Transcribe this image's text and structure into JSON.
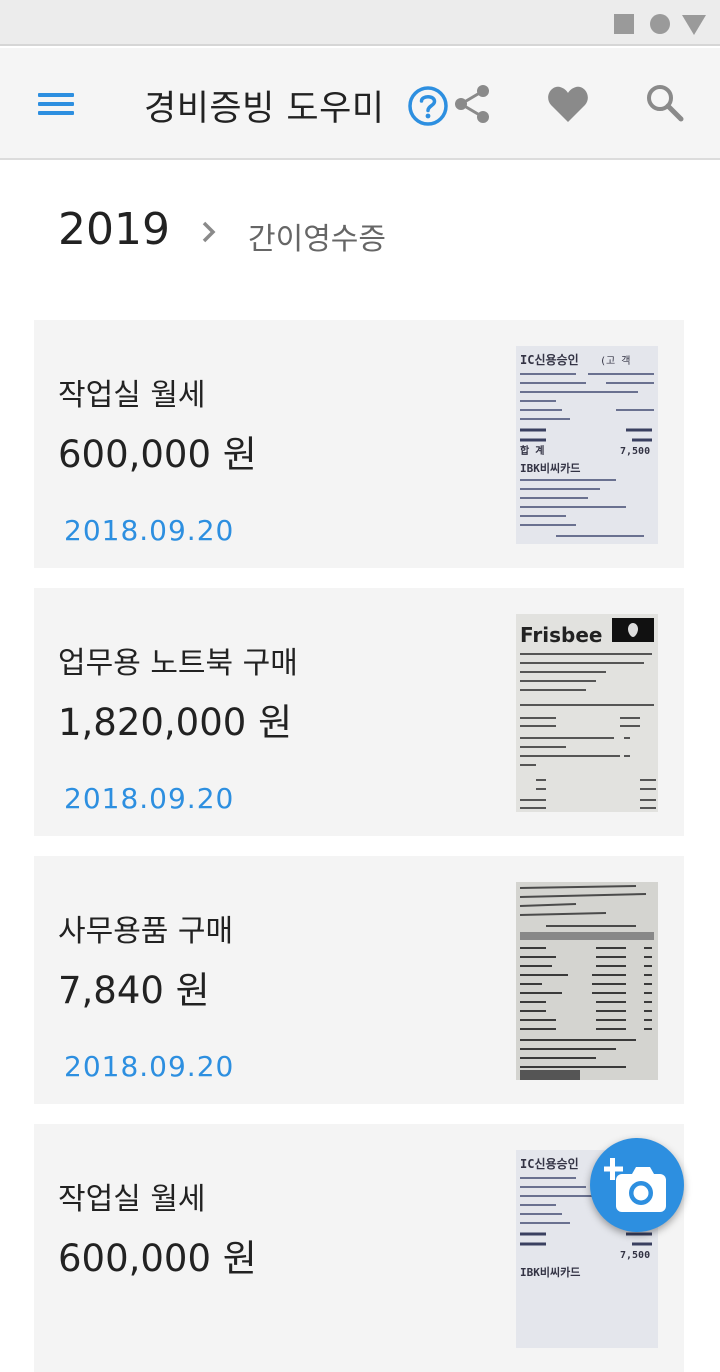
{
  "app": {
    "title": "경비증빙 도우미",
    "accent_color": "#2d8fe0"
  },
  "toolbar": {
    "menu_icon": "hamburger-menu-icon",
    "help_icon": "question-circle-icon",
    "share_icon": "share-icon",
    "favorite_icon": "heart-icon",
    "search_icon": "search-icon"
  },
  "breadcrumb": {
    "year": "2019",
    "separator_icon": "chevron-right-icon",
    "category": "간이영수증"
  },
  "expenses": [
    {
      "title": "작업실 월세",
      "amount": "600,000 원",
      "date": "2018.09.20",
      "receipt": "card-receipt"
    },
    {
      "title": "업무용 노트북 구매",
      "amount": "1,820,000 원",
      "date": "2018.09.20",
      "receipt": "frisbee-receipt"
    },
    {
      "title": "사무용품 구매",
      "amount": "7,840 원",
      "date": "2018.09.20",
      "receipt": "store-receipt"
    },
    {
      "title": "작업실 월세",
      "amount": "600,000 원",
      "date": "",
      "receipt": "card-receipt"
    }
  ],
  "receipt_text": {
    "card_header": "IC신용승인",
    "card_bank": "IBK비씨카드",
    "card_total": "7,500",
    "frisbee_logo": "Frisbee"
  },
  "fab": {
    "icon": "add-photo-camera-icon"
  }
}
